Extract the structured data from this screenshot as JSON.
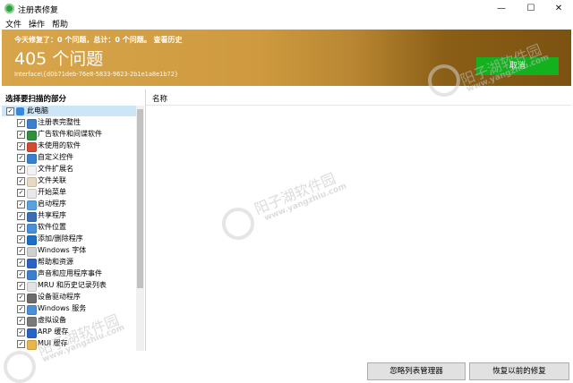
{
  "window": {
    "title": "注册表修复",
    "minimize": "—",
    "maximize": "☐",
    "close": "✕"
  },
  "menu": [
    "文件",
    "操作",
    "帮助"
  ],
  "banner": {
    "summary": "今天修复了：0 个问题，总计：0 个问题。 查看历史",
    "count": "405 个问题",
    "interface": "Interface\\{d0b71deb-76e8-5833-9623-2b1e1a8e1b72}",
    "cancel": "取消",
    "colors": {
      "gold": "#d8a54b",
      "dark": "#7b5210",
      "green": "#14b11e"
    }
  },
  "left_panel": {
    "header": "选择要扫描的部分",
    "root": "此电脑",
    "items": [
      {
        "label": "注册表完整性",
        "icon": "#3b7fd1"
      },
      {
        "label": "广告软件和间谍软件",
        "icon": "#2f8f3d"
      },
      {
        "label": "未使用的软件",
        "icon": "#d24b33"
      },
      {
        "label": "自定义控件",
        "icon": "#3b7fd1"
      },
      {
        "label": "文件扩展名",
        "icon": "#f2f2f2"
      },
      {
        "label": "文件关联",
        "icon": "#e8d9c0"
      },
      {
        "label": "开始菜单",
        "icon": "#e9e9e9"
      },
      {
        "label": "启动程序",
        "icon": "#5aa1e3"
      },
      {
        "label": "共享程序",
        "icon": "#3a6fb8"
      },
      {
        "label": "软件位置",
        "icon": "#4a90d9"
      },
      {
        "label": "添加/删除程序",
        "icon": "#1a6fc9"
      },
      {
        "label": "Windows 字体",
        "icon": "#d0d0d0"
      },
      {
        "label": "帮助和资源",
        "icon": "#2a63c6"
      },
      {
        "label": "声音和应用程序事件",
        "icon": "#3b7fd1"
      },
      {
        "label": "MRU 和历史记录列表",
        "icon": "#e3e3e3"
      },
      {
        "label": "设备驱动程序",
        "icon": "#6b6b6b"
      },
      {
        "label": "Windows 服务",
        "icon": "#4a90d9"
      },
      {
        "label": "虚拟设备",
        "icon": "#7a7a7a"
      },
      {
        "label": "ARP 缓存",
        "icon": "#2a63c6"
      },
      {
        "label": "MUI 缓存",
        "icon": "#e8b64a"
      }
    ]
  },
  "right_panel": {
    "column_name": "名称"
  },
  "bottom": {
    "ignore_btn": "忽略列表管理器",
    "restore_btn": "恢复以前的修复"
  },
  "watermark": {
    "cn": "阳子湖软件园",
    "url": "www.yangzhiu.com"
  }
}
